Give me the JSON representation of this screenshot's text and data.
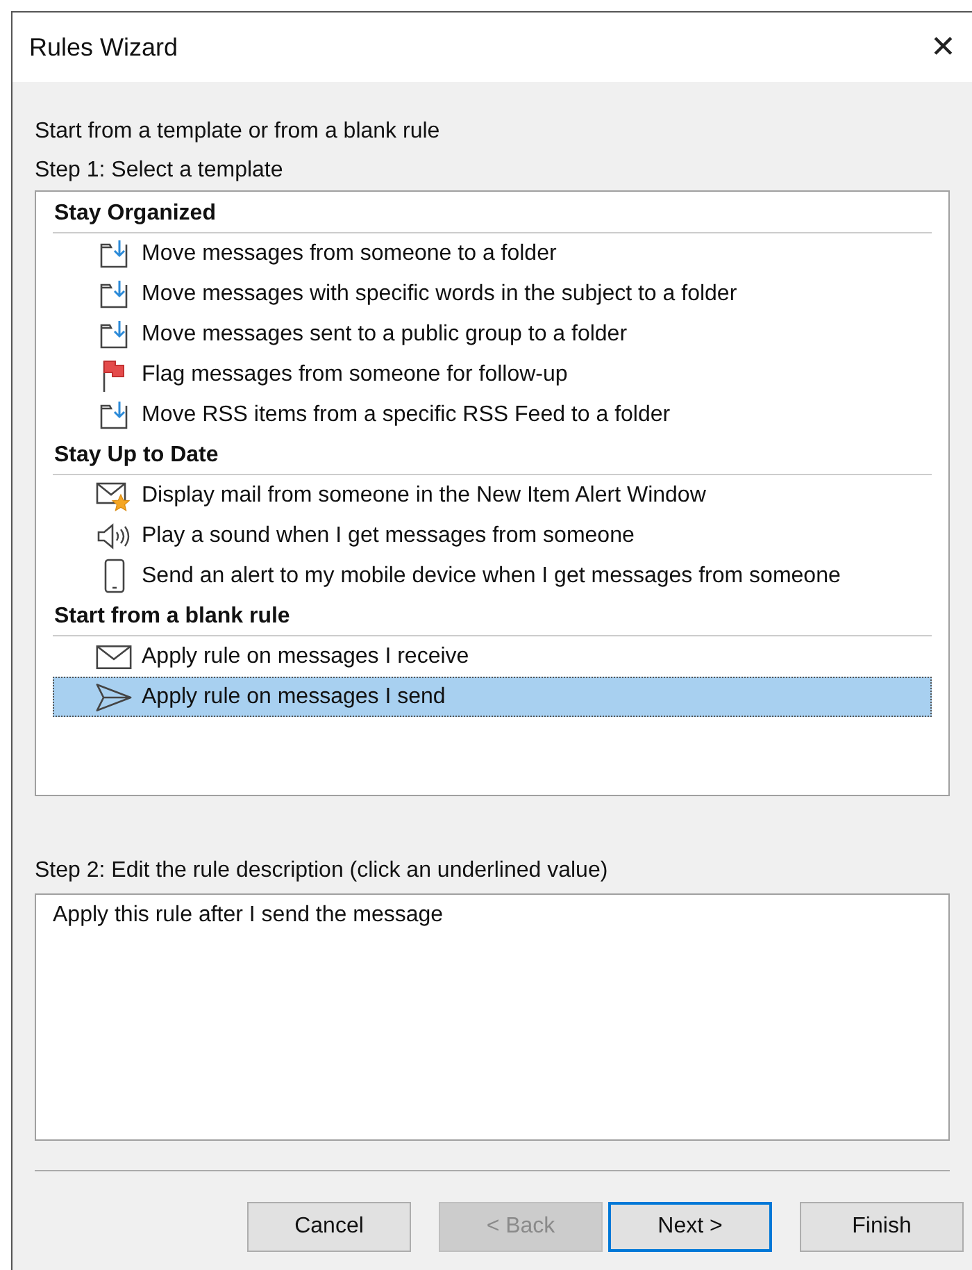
{
  "window": {
    "title": "Rules Wizard",
    "close": "✕"
  },
  "intro": "Start from a template or from a blank rule",
  "step1": "Step 1: Select a template",
  "groups": [
    {
      "title": "Stay Organized",
      "items": [
        {
          "kind": "move",
          "label": "Move messages from someone to a folder",
          "selected": false
        },
        {
          "kind": "move",
          "label": "Move messages with specific words in the subject to a folder",
          "selected": false
        },
        {
          "kind": "move",
          "label": "Move messages sent to a public group to a folder",
          "selected": false
        },
        {
          "kind": "flag",
          "label": "Flag messages from someone for follow-up",
          "selected": false
        },
        {
          "kind": "move",
          "label": "Move RSS items from a specific RSS Feed to a folder",
          "selected": false
        }
      ]
    },
    {
      "title": "Stay Up to Date",
      "items": [
        {
          "kind": "alert",
          "label": "Display mail from someone in the New Item Alert Window",
          "selected": false
        },
        {
          "kind": "sound",
          "label": "Play a sound when I get messages from someone",
          "selected": false
        },
        {
          "kind": "mobile",
          "label": "Send an alert to my mobile device when I get messages from someone",
          "selected": false
        }
      ]
    },
    {
      "title": "Start from a blank rule",
      "items": [
        {
          "kind": "receive",
          "label": "Apply rule on messages I receive",
          "selected": false
        },
        {
          "kind": "send",
          "label": "Apply rule on messages I send",
          "selected": true
        }
      ]
    }
  ],
  "step2": "Step 2: Edit the rule description (click an underlined value)",
  "description": "Apply this rule after I send the message",
  "buttons": [
    {
      "label": "Cancel",
      "disabled": false,
      "default": false
    },
    {
      "label": "< Back",
      "disabled": true,
      "default": false
    },
    {
      "label": "Next >",
      "disabled": false,
      "default": true
    },
    {
      "label": "Finish",
      "disabled": false,
      "default": false
    }
  ]
}
